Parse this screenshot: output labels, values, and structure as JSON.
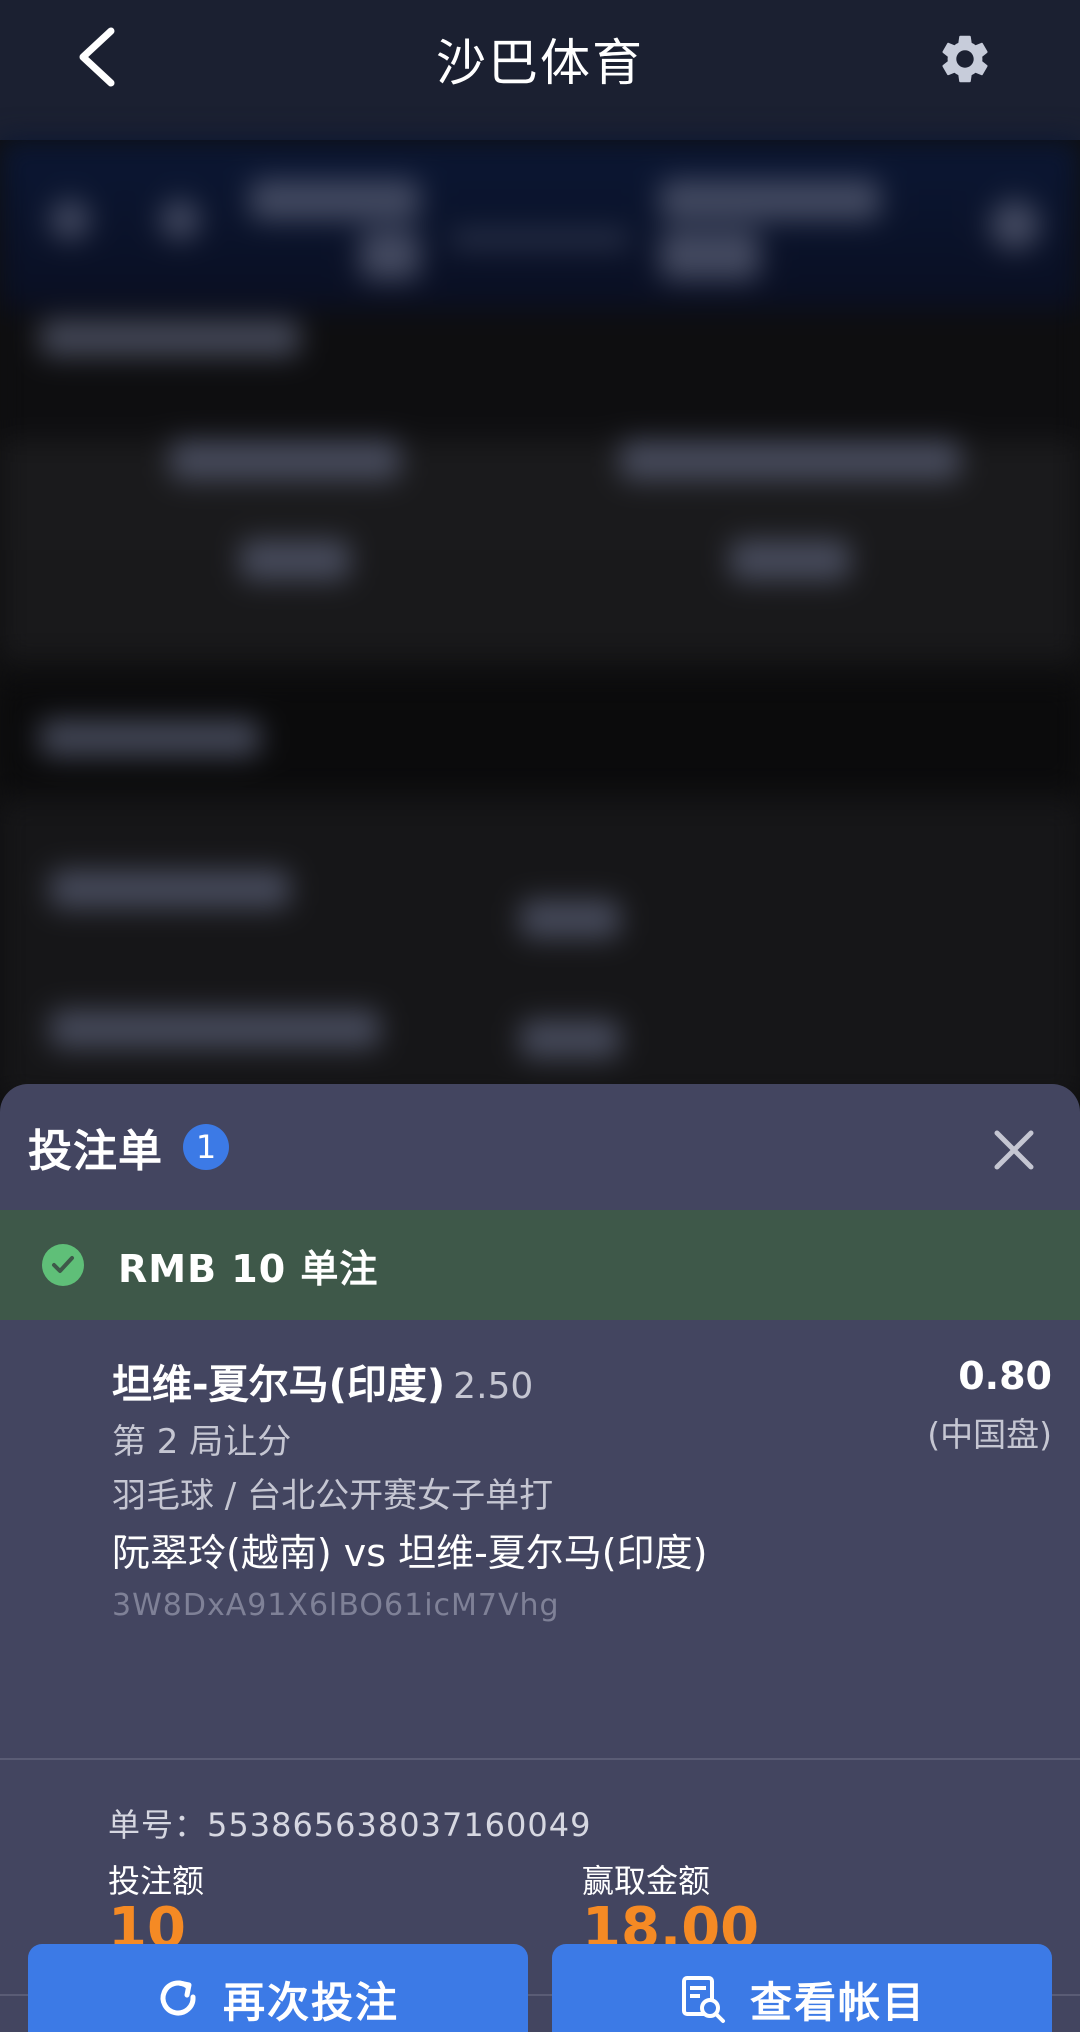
{
  "header": {
    "title": "沙巴体育"
  },
  "betslip": {
    "title": "投注单",
    "count": "1",
    "status_text": "RMB 10 单注",
    "selection": {
      "name": "坦维-夏尔马(印度)",
      "handicap": "2.50",
      "odds": "0.80",
      "odds_type": "(中国盘)",
      "market": "第 2 局让分",
      "league": "羽毛球 / 台北公开赛女子单打",
      "match": "阮翠玲(越南) vs 坦维-夏尔马(印度)",
      "code": "3W8DxA91X6lBO61icM7Vhg"
    },
    "ticket_line": "单号：553865638037160049",
    "stake_label": "投注额",
    "stake_value": "10",
    "win_label": "赢取金额",
    "win_value": "18.00",
    "buttons": {
      "rebet": "再次投注",
      "account": "查看帐目"
    }
  },
  "colors": {
    "accent_blue": "#3c7ae6",
    "amount_orange": "#f58a24",
    "success_green": "#5fbf78",
    "sheet_bg": "#434560",
    "topbar_bg": "#1b2031"
  }
}
